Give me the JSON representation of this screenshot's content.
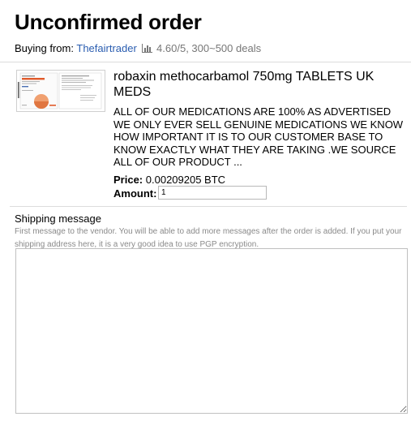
{
  "page": {
    "title": "Unconfirmed order"
  },
  "vendor": {
    "prefix": "Buying from:",
    "name": "Thefairtrader",
    "rating": "4.60/5, 300~500 deals"
  },
  "product": {
    "image_alt": "robaxin-750 box",
    "name": "robaxin methocarbamol 750mg TABLETS UK MEDS",
    "description": "ALL OF OUR MEDICATIONS ARE 100% AS ADVERTISED WE ONLY EVER SELL GENUINE MEDICATIONS WE KNOW HOW IMPORTANT IT IS TO OUR CUSTOMER BASE TO KNOW EXACTLY WHAT THEY ARE TAKING .WE SOURCE ALL OF OUR PRODUCT ...",
    "price_label": "Price:",
    "price_value": "0.00209205 BTC",
    "amount_label": "Amount:",
    "amount_value": "1"
  },
  "shipping": {
    "label": "Shipping message",
    "hint": "First message to the vendor. You will be able to add more messages after the order is added. If you put your shipping address here, it is a very good idea to use PGP encryption.",
    "value": ""
  },
  "colors": {
    "link": "#2a5db0",
    "hint_text": "#8a8a8a",
    "divider": "#dcdcdc"
  }
}
